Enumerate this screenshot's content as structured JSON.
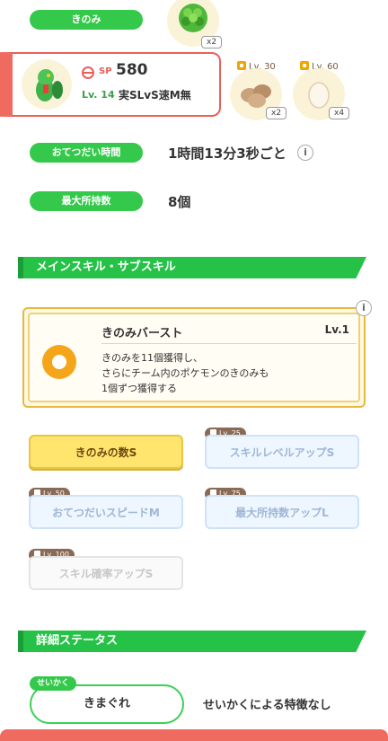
{
  "berry": {
    "label": "きのみ",
    "quantity": "x2"
  },
  "pokemon": {
    "sp_label": "SP",
    "sp_value": "580",
    "level": "Lv. 14",
    "build": "実SLvS速M無"
  },
  "ingredients": [
    {
      "unlock_level": "Lv. 30",
      "quantity": "x2"
    },
    {
      "unlock_level": "Lv. 60",
      "quantity": "x4"
    }
  ],
  "help_time": {
    "label": "おてつだい時間",
    "value": "1時間13分3秒ごと"
  },
  "max_carry": {
    "label": "最大所持数",
    "value": "8個"
  },
  "main_skill_section": {
    "title": "メインスキル・サブスキル"
  },
  "main_skill": {
    "name": "きのみバースト",
    "level": "Lv.1",
    "desc_line1": "きのみを11個獲得し、",
    "desc_line2": "さらにチーム内のポケモンのきのみも",
    "desc_line3": "1個ずつ獲得する"
  },
  "sub_skills": [
    {
      "name": "きのみの数S",
      "unlock": ""
    },
    {
      "name": "スキルレベルアップS",
      "unlock": "Lv. 25"
    },
    {
      "name": "おてつだいスピードM",
      "unlock": "Lv. 50"
    },
    {
      "name": "最大所持数アップL",
      "unlock": "Lv. 75"
    },
    {
      "name": "スキル確率アップS",
      "unlock": "Lv. 100"
    }
  ],
  "details_section": {
    "title": "詳細ステータス"
  },
  "nature": {
    "tag": "せいかく",
    "name": "きまぐれ",
    "effect": "せいかくによる特徴なし"
  },
  "colors": {
    "green": "#35c94c",
    "accent_red": "#ef6b5f",
    "gold": "#ffe56e"
  }
}
